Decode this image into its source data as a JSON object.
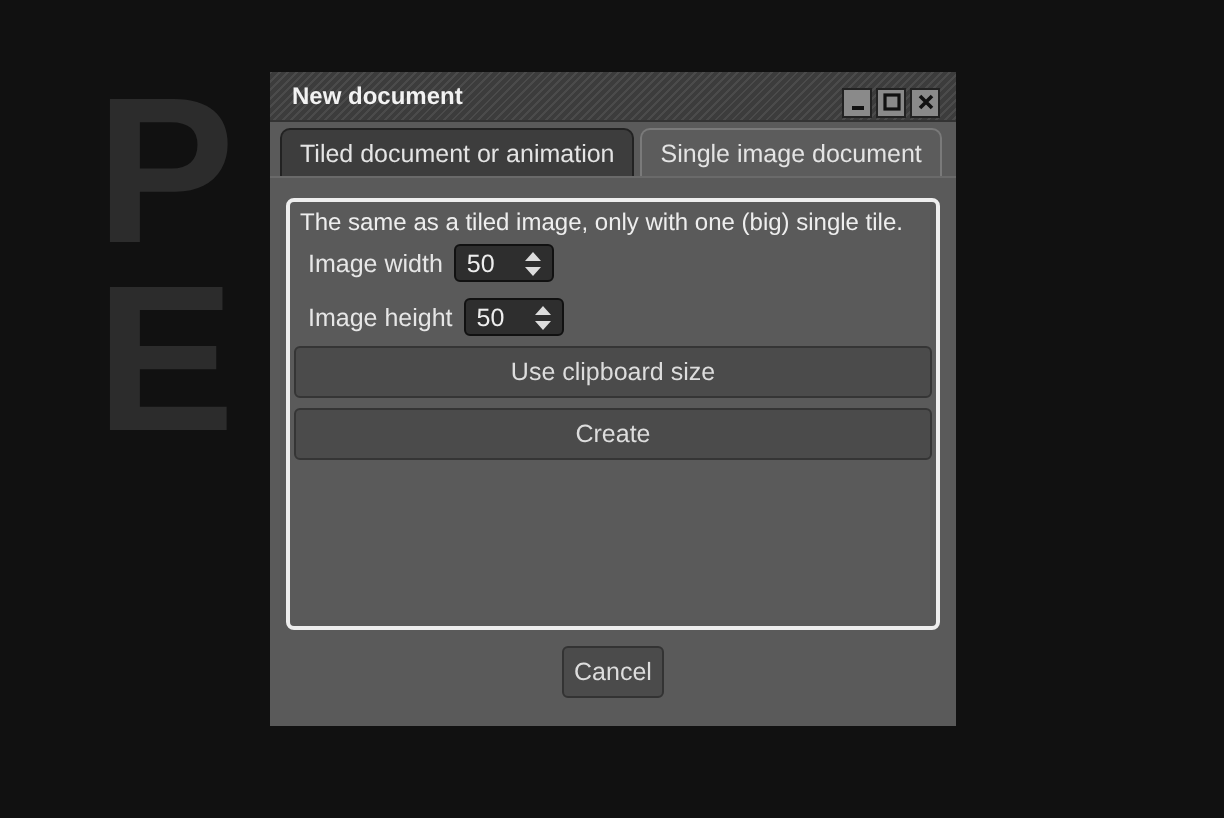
{
  "background_logo": {
    "lines": [
      "P",
      "E"
    ]
  },
  "window": {
    "title": "New document",
    "controls": [
      {
        "kind": "minimize"
      },
      {
        "kind": "maximize"
      },
      {
        "kind": "close"
      }
    ]
  },
  "tabs": [
    {
      "label": "Tiled document or animation",
      "selected": false
    },
    {
      "label": "Single image document",
      "selected": true
    }
  ],
  "panel": {
    "description": "The same as a tiled image, only with one (big) single tile.",
    "fields": [
      {
        "label": "Image width",
        "value": "50"
      },
      {
        "label": "Image height",
        "value": "50"
      }
    ],
    "buttons": [
      "Use clipboard size",
      "Create"
    ]
  },
  "footer_buttons": [
    "Cancel"
  ]
}
